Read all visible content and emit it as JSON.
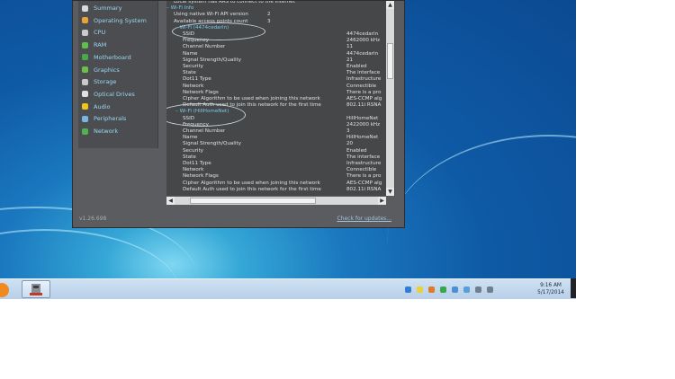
{
  "content_lines": [
    {
      "text": "Local system has RAS to connect to the Internet",
      "value": ""
    },
    {
      "text": "– Wi-Fi Info",
      "value": "",
      "header": true
    },
    {
      "text": "Using native Wi-Fi API version",
      "value": "2"
    },
    {
      "text": "Available access points count",
      "value": "3"
    },
    {
      "text": "– Wi-Fi (4474cedarln)",
      "value": "",
      "header": true
    },
    {
      "text": "SSID",
      "value": "4474cedarln"
    },
    {
      "text": "Frequency",
      "value": "2462000 kHz"
    },
    {
      "text": "Channel Number",
      "value": "11"
    },
    {
      "text": "Name",
      "value": "4474cedarln"
    },
    {
      "text": "Signal Strength/Quality",
      "value": "21"
    },
    {
      "text": "Security",
      "value": "Enabled"
    },
    {
      "text": "State",
      "value": "The interface"
    },
    {
      "text": "Dot11 Type",
      "value": "Infrastructure"
    },
    {
      "text": "Network",
      "value": "Connectible"
    },
    {
      "text": "Network Flags",
      "value": "There is a pro"
    },
    {
      "text": "Cipher Algorithm to be used when joining this network",
      "value": "AES-CCMP alg"
    },
    {
      "text": "Default Auth used to join this network for the first time",
      "value": "802.11i RSNA"
    },
    {
      "text": "– Wi-Fi (HillHomeNet)",
      "value": "",
      "header": true
    },
    {
      "text": "SSID",
      "value": "HillHomeNet"
    },
    {
      "text": "Frequency",
      "value": "2422000 kHz"
    },
    {
      "text": "Channel Number",
      "value": "3"
    },
    {
      "text": "Name",
      "value": "HillHomeNet"
    },
    {
      "text": "Signal Strength/Quality",
      "value": "20"
    },
    {
      "text": "Security",
      "value": "Enabled"
    },
    {
      "text": "State",
      "value": "The interface"
    },
    {
      "text": "Dot11 Type",
      "value": "Infrastructure"
    },
    {
      "text": "Network",
      "value": "Connectible"
    },
    {
      "text": "Network Flags",
      "value": "There is a pro"
    },
    {
      "text": "Cipher Algorithm to be used when joining this network",
      "value": "AES-CCMP alg"
    },
    {
      "text": "Default Auth used to join this network for the first time",
      "value": "802.11i RSNA"
    }
  ],
  "sidebar": {
    "items": [
      {
        "label": "Summary",
        "icon": "summary-icon",
        "color": "#d9d9d9"
      },
      {
        "label": "Operating System",
        "icon": "windows-icon",
        "color": "#e8a33a"
      },
      {
        "label": "CPU",
        "icon": "cpu-icon",
        "color": "#c9c9c9"
      },
      {
        "label": "RAM",
        "icon": "ram-icon",
        "color": "#5fbf4a"
      },
      {
        "label": "Motherboard",
        "icon": "motherboard-icon",
        "color": "#4aa84a"
      },
      {
        "label": "Graphics",
        "icon": "graphics-icon",
        "color": "#6cc04a"
      },
      {
        "label": "Storage",
        "icon": "storage-icon",
        "color": "#c9c9c9"
      },
      {
        "label": "Optical Drives",
        "icon": "optical-drive-icon",
        "color": "#e0e0e0"
      },
      {
        "label": "Audio",
        "icon": "audio-icon",
        "color": "#f0c419"
      },
      {
        "label": "Peripherals",
        "icon": "peripherals-icon",
        "color": "#78b6e0"
      },
      {
        "label": "Network",
        "icon": "network-icon",
        "color": "#4fb34f"
      }
    ]
  },
  "footer": {
    "version": "v1.26.698",
    "check_updates": "Check for updates..."
  },
  "taskbar": {
    "time": "9:16 AM",
    "date": "5/17/2014",
    "tray_icons": [
      "shield-icon",
      "notes-icon",
      "flag-icon",
      "battery-icon",
      "network-icon",
      "action-center-icon",
      "screen-icon",
      "speaker-icon"
    ],
    "app_icon": "speccy-icon"
  },
  "colors": {
    "accent": "#79c9ee",
    "window_bg": "#5a5c5f",
    "taskbar": "#c3d8ee"
  }
}
